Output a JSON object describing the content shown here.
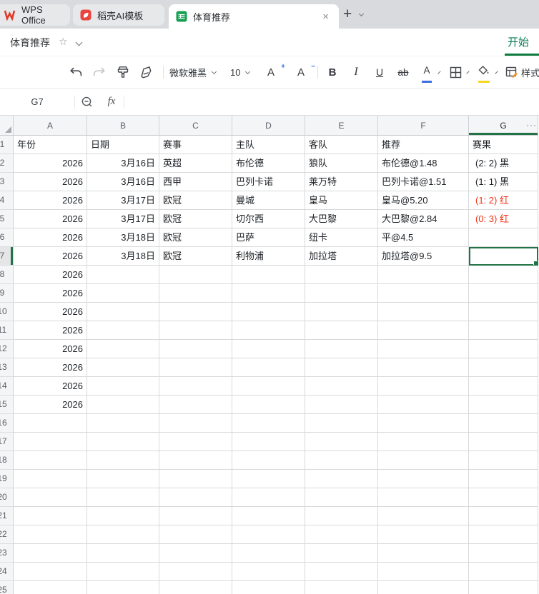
{
  "app": {
    "tab_bar": {
      "tabs": [
        {
          "label": "WPS Office",
          "active": false
        },
        {
          "label": "稻壳AI模板",
          "active": false
        },
        {
          "label": "体育推荐",
          "active": true,
          "close": "×"
        }
      ],
      "new_tab_label": "+"
    },
    "title_bar": {
      "title": "体育推荐",
      "star": "☆",
      "ribbon_tab": "开始"
    },
    "toolbar": {
      "font_name": "微软雅黑",
      "font_size": "10",
      "increase_font": {
        "letter": "A",
        "sign": "+"
      },
      "decrease_font": {
        "letter": "A",
        "sign": "−"
      },
      "bold": "B",
      "italic": "I",
      "underline": "U",
      "strikethrough": "ab",
      "font_color_letter": "A",
      "style_label": "样式"
    },
    "formula_bar": {
      "cell_ref": "G7",
      "fx_label": "fx",
      "formula_value": ""
    }
  },
  "colors": {
    "selection_green": "#217346",
    "ribbon_green": "#0f7f5a",
    "result_red": "#f23318",
    "font_color_bar": "#3c6fe0",
    "fill_color_bar": "#f5d623",
    "sheet_icon_green": "#1aa053",
    "docer_icon_red": "#e8453f",
    "wps_logo_red": "#e03a2a"
  },
  "sheet": {
    "active_cell": "G7",
    "active_col": "G",
    "column_letters": [
      "A",
      "B",
      "C",
      "D",
      "E",
      "F",
      "G"
    ],
    "more_columns_indicator": "···",
    "row_count": 25,
    "rows": [
      {
        "n": 1,
        "header": true,
        "cells": [
          "年份",
          "日期",
          "赛事",
          "主队",
          "客队",
          "推荐",
          "赛果"
        ]
      },
      {
        "n": 2,
        "cells": [
          "2026",
          "3月16日",
          "英超",
          "布伦德",
          "狼队",
          "布伦德@1.48",
          "(2: 2) 黑"
        ]
      },
      {
        "n": 3,
        "cells": [
          "2026",
          "3月16日",
          "西甲",
          "巴列卡诺",
          "莱万特",
          "巴列卡诺@1.51",
          "(1: 1) 黑"
        ]
      },
      {
        "n": 4,
        "result_red": true,
        "cells": [
          "2026",
          "3月17日",
          "欧冠",
          "曼城",
          "皇马",
          "皇马@5.20",
          "(1: 2) 红"
        ]
      },
      {
        "n": 5,
        "result_red": true,
        "cells": [
          "2026",
          "3月17日",
          "欧冠",
          "切尔西",
          "大巴黎",
          "大巴黎@2.84",
          "(0: 3) 红"
        ]
      },
      {
        "n": 6,
        "cells": [
          "2026",
          "3月18日",
          "欧冠",
          "巴萨",
          "纽卡",
          "平@4.5",
          ""
        ]
      },
      {
        "n": 7,
        "active_row": true,
        "active_cell": "G",
        "cells": [
          "2026",
          "3月18日",
          "欧冠",
          "利物浦",
          "加拉塔",
          "加拉塔@9.5",
          ""
        ]
      },
      {
        "n": 8,
        "cells": [
          "2026",
          "",
          "",
          "",
          "",
          "",
          ""
        ]
      },
      {
        "n": 9,
        "cells": [
          "2026",
          "",
          "",
          "",
          "",
          "",
          ""
        ]
      },
      {
        "n": 10,
        "cells": [
          "2026",
          "",
          "",
          "",
          "",
          "",
          ""
        ]
      },
      {
        "n": 11,
        "cells": [
          "2026",
          "",
          "",
          "",
          "",
          "",
          ""
        ]
      },
      {
        "n": 12,
        "cells": [
          "2026",
          "",
          "",
          "",
          "",
          "",
          ""
        ]
      },
      {
        "n": 13,
        "cells": [
          "2026",
          "",
          "",
          "",
          "",
          "",
          ""
        ]
      },
      {
        "n": 14,
        "cells": [
          "2026",
          "",
          "",
          "",
          "",
          "",
          ""
        ]
      },
      {
        "n": 15,
        "cells": [
          "2026",
          "",
          "",
          "",
          "",
          "",
          ""
        ]
      }
    ]
  }
}
